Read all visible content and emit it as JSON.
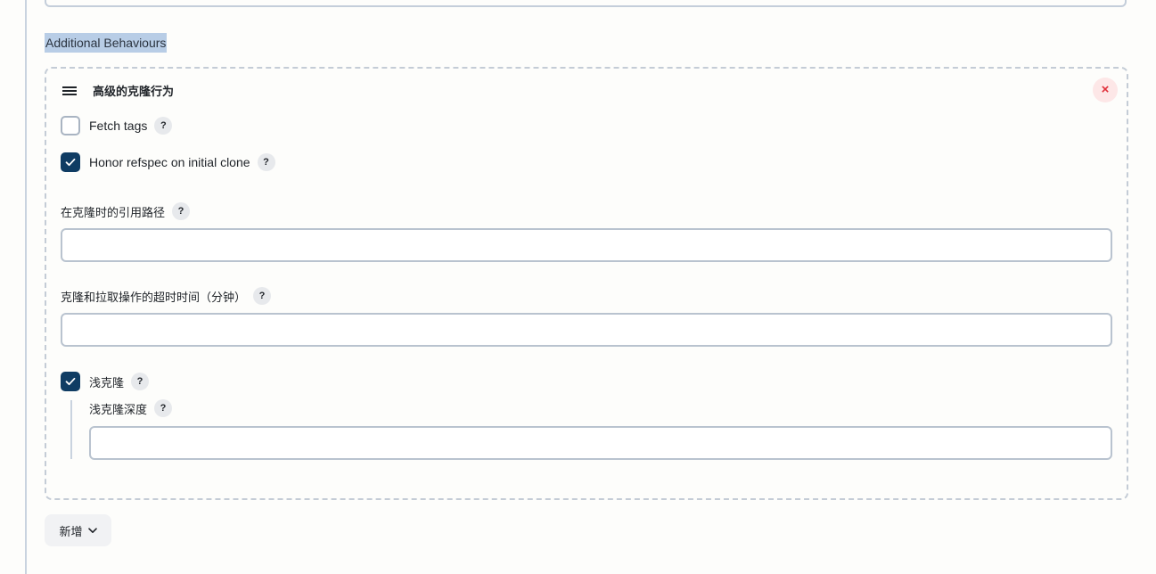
{
  "section": {
    "heading": "Additional Behaviours"
  },
  "card": {
    "title": "高级的克隆行为",
    "close_symbol": "×",
    "fetch_tags": {
      "label": "Fetch tags",
      "checked": false
    },
    "honor_refspec": {
      "label": "Honor refspec on initial clone",
      "checked": true
    },
    "reference_path": {
      "label": "在克隆时的引用路径",
      "value": ""
    },
    "timeout": {
      "label": "克隆和拉取操作的超时时间（分钟）",
      "value": ""
    },
    "shallow_clone": {
      "label": "浅克隆",
      "checked": true,
      "depth_label": "浅克隆深度",
      "depth_value": ""
    }
  },
  "help_symbol": "?",
  "add_button": {
    "label": "新增"
  },
  "colors": {
    "accent": "#0f3c63",
    "close": "#e0303a",
    "selection_highlight": "#b8cde6"
  },
  "icons": [
    "drag-handle-icon",
    "close-icon",
    "help-icon",
    "checkmark-icon",
    "chevron-down-icon"
  ]
}
